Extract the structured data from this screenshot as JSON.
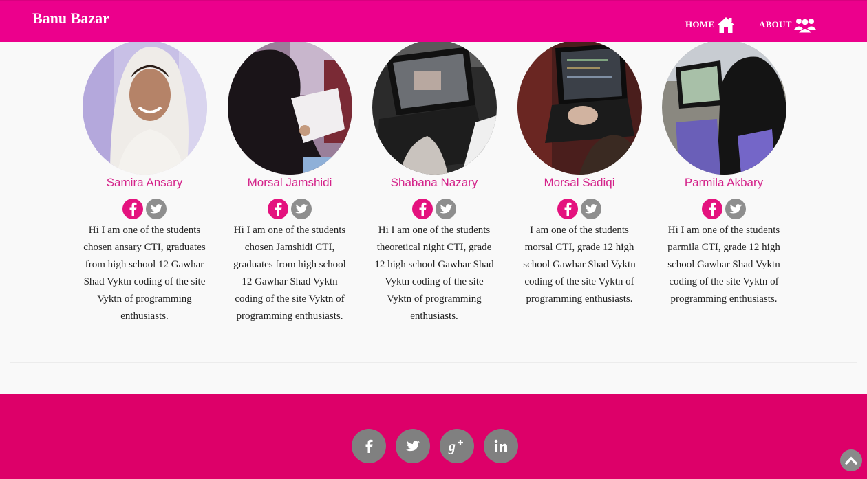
{
  "header": {
    "brand": "Banu Bazar",
    "nav": {
      "home_label": "HOME",
      "home_icon": "home-icon",
      "about_label": "ABOUT",
      "about_icon": "users-icon"
    }
  },
  "colors": {
    "brand_pink": "#ec008c",
    "name_pink": "#d4238a",
    "footer_pink": "#dd0069",
    "icon_gray": "#808080"
  },
  "team": [
    {
      "name": "Samira Ansary",
      "bio": "Hi I am one of the students chosen ansary CTI, graduates from high school 12 Gawhar Shad Vyktn coding of the site Vyktn of programming enthusiasts."
    },
    {
      "name": "Morsal Jamshidi",
      "bio": "Hi I am one of the students chosen Jamshidi CTI, graduates from high school 12 Gawhar Shad Vyktn coding of the site Vyktn of programming enthusiasts."
    },
    {
      "name": "Shabana Nazary",
      "bio": "Hi I am one of the students theoretical night CTI, grade 12 high school Gawhar Shad Vyktn coding of the site Vyktn of programming enthusiasts."
    },
    {
      "name": "Morsal Sadiqi",
      "bio": "I am one of the students morsal CTI, grade 12 high school Gawhar Shad Vyktn coding of the site Vyktn of programming enthusiasts."
    },
    {
      "name": "Parmila Akbary",
      "bio": "Hi I am one of the students parmila CTI, grade 12 high school Gawhar Shad Vyktn coding of the site Vyktn of programming enthusiasts."
    }
  ],
  "footer": {
    "socials": [
      "facebook-icon",
      "twitter-icon",
      "google-plus-icon",
      "linkedin-icon"
    ]
  }
}
